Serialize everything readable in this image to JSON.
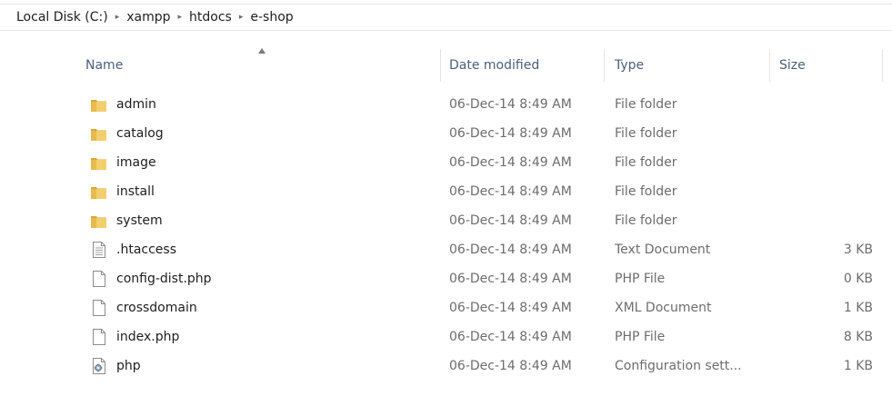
{
  "breadcrumb": [
    "Local Disk (C:)",
    "xampp",
    "htdocs",
    "e-shop"
  ],
  "breadcrumb_separator": "▸",
  "columns": {
    "name": "Name",
    "date": "Date modified",
    "type": "Type",
    "size": "Size"
  },
  "files": [
    {
      "name": "admin",
      "date": "06-Dec-14 8:49 AM",
      "type": "File folder",
      "size": "",
      "icon": "folder-icon"
    },
    {
      "name": "catalog",
      "date": "06-Dec-14 8:49 AM",
      "type": "File folder",
      "size": "",
      "icon": "folder-icon"
    },
    {
      "name": "image",
      "date": "06-Dec-14 8:49 AM",
      "type": "File folder",
      "size": "",
      "icon": "folder-icon"
    },
    {
      "name": "install",
      "date": "06-Dec-14 8:49 AM",
      "type": "File folder",
      "size": "",
      "icon": "folder-icon"
    },
    {
      "name": "system",
      "date": "06-Dec-14 8:49 AM",
      "type": "File folder",
      "size": "",
      "icon": "folder-icon"
    },
    {
      "name": ".htaccess",
      "date": "06-Dec-14 8:49 AM",
      "type": "Text Document",
      "size": "3 KB",
      "icon": "text-document-icon"
    },
    {
      "name": "config-dist.php",
      "date": "06-Dec-14 8:49 AM",
      "type": "PHP File",
      "size": "0 KB",
      "icon": "file-icon"
    },
    {
      "name": "crossdomain",
      "date": "06-Dec-14 8:49 AM",
      "type": "XML Document",
      "size": "1 KB",
      "icon": "file-icon"
    },
    {
      "name": "index.php",
      "date": "06-Dec-14 8:49 AM",
      "type": "PHP File",
      "size": "8 KB",
      "icon": "file-icon"
    },
    {
      "name": "php",
      "date": "06-Dec-14 8:49 AM",
      "type": "Configuration sett...",
      "size": "1 KB",
      "icon": "config-settings-icon"
    }
  ]
}
